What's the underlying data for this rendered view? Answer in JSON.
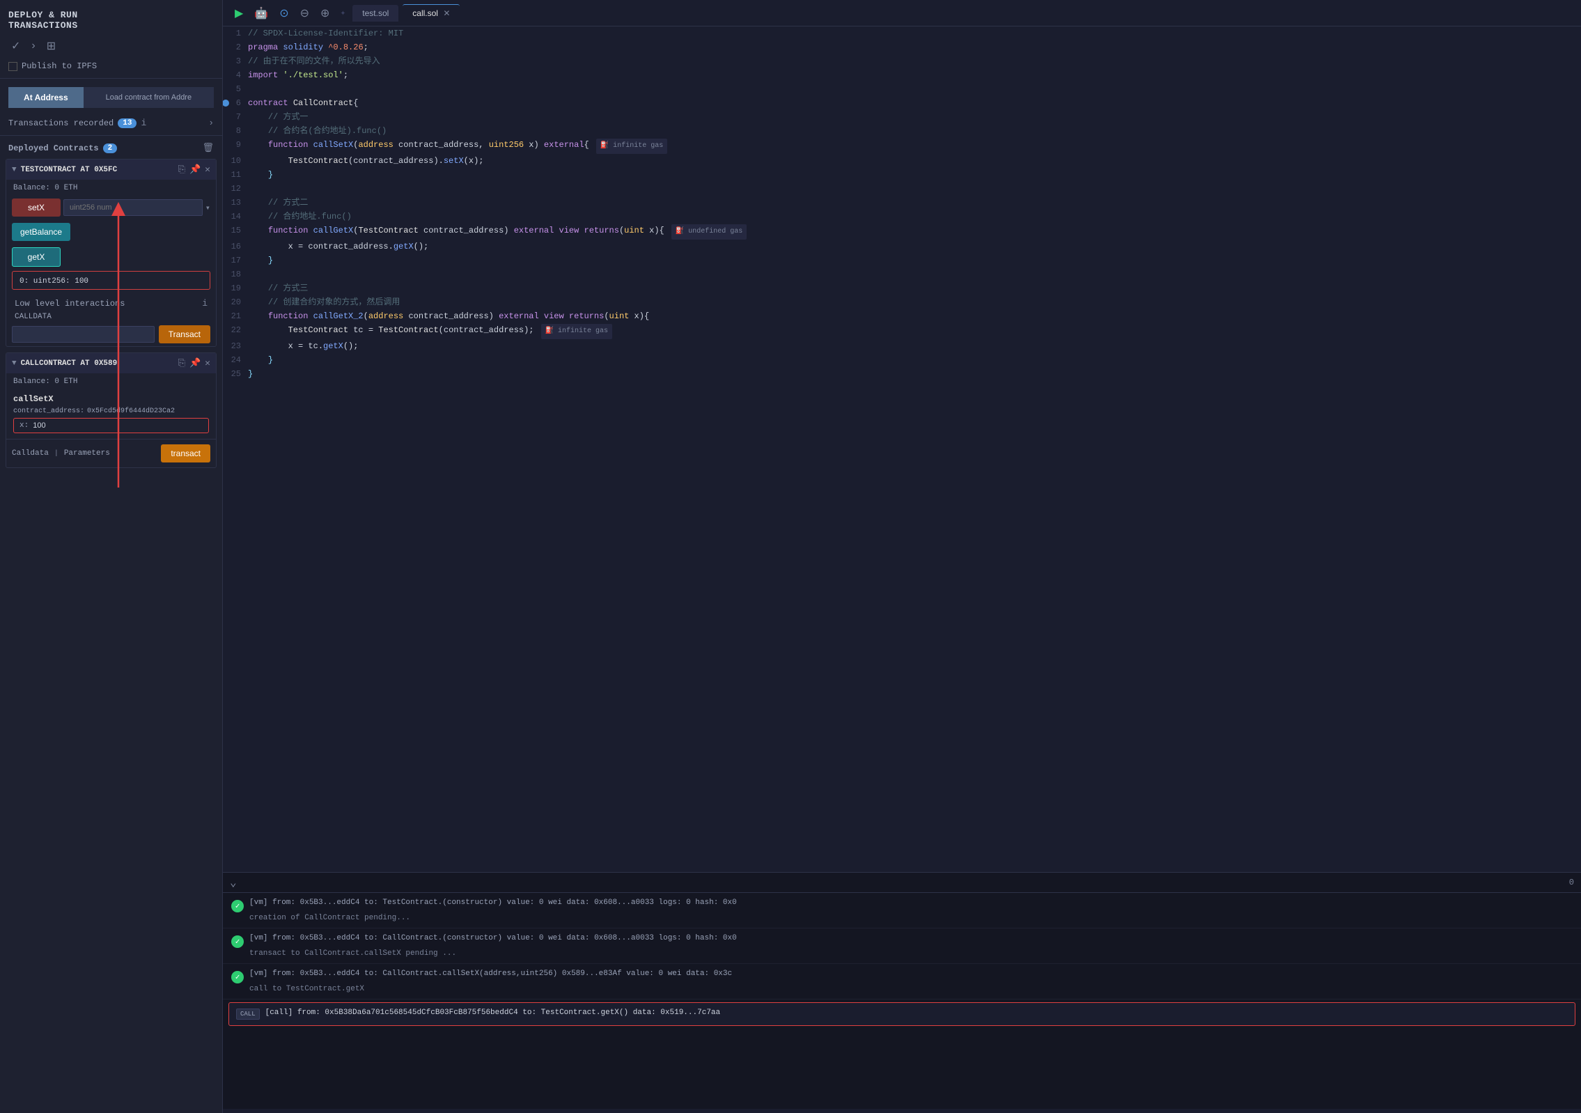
{
  "left": {
    "title": "DEPLOY & RUN\nTRANSACTIONS",
    "publish_label": "Publish to IPFS",
    "at_address_btn": "At Address",
    "load_contract_btn": "Load contract from Addre",
    "transactions_label": "Transactions recorded",
    "transactions_count": "13",
    "deployed_label": "Deployed Contracts",
    "deployed_count": "2",
    "contract1": {
      "name": "TESTCONTRACT AT 0X5FC",
      "balance": "Balance: 0 ETH",
      "func1_label": "setX",
      "func1_placeholder": "uint256 num",
      "func2_label": "getBalance",
      "func3_label": "getX",
      "func3_result": "0: uint256: 100"
    },
    "low_level": {
      "title": "Low level interactions",
      "calldata_label": "CALLDATA",
      "transact_btn": "Transact"
    },
    "contract2": {
      "name": "CALLCONTRACT AT 0X589",
      "balance": "Balance: 0 ETH",
      "section_label": "callSetX",
      "param1_label": "contract_address:",
      "param1_value": "0x5Fcd5d9f6444dD23Ca2",
      "x_label": "x:",
      "x_value": "100",
      "calldata_label": "Calldata",
      "params_label": "Parameters",
      "transact_btn": "transact"
    }
  },
  "editor": {
    "toolbar": {
      "play_icon": "▶",
      "robot_icon": "🤖",
      "toggle_icon": "⊙",
      "zoom_out_icon": "⊖",
      "zoom_in_icon": "⊕",
      "tab1_label": "test.sol",
      "tab2_label": "call.sol"
    },
    "lines": [
      {
        "num": 1,
        "content": "// SPDX-License-Identifier: MIT"
      },
      {
        "num": 2,
        "content": "pragma solidity ^0.8.26;"
      },
      {
        "num": 3,
        "content": "// 由于在不同的文件，所以先导入"
      },
      {
        "num": 4,
        "content": "import './test.sol';"
      },
      {
        "num": 5,
        "content": ""
      },
      {
        "num": 6,
        "content": "contract CallContract{"
      },
      {
        "num": 7,
        "content": "    // 方式一"
      },
      {
        "num": 8,
        "content": "    // 合约名(合约地址).func()"
      },
      {
        "num": 9,
        "content": "    function callSetX(address contract_address, uint256 x) external{",
        "gas": "infinite gas"
      },
      {
        "num": 10,
        "content": "        TestContract(contract_address).setX(x);"
      },
      {
        "num": 11,
        "content": "    }"
      },
      {
        "num": 12,
        "content": ""
      },
      {
        "num": 13,
        "content": "    // 方式二"
      },
      {
        "num": 14,
        "content": "    // 合约地址.func()"
      },
      {
        "num": 15,
        "content": "    function callGetX(TestContract contract_address) external view returns(uint x){",
        "gas": "undefined gas"
      },
      {
        "num": 16,
        "content": "        x = contract_address.getX();"
      },
      {
        "num": 17,
        "content": "    }"
      },
      {
        "num": 18,
        "content": ""
      },
      {
        "num": 19,
        "content": "    // 方式三"
      },
      {
        "num": 20,
        "content": "    // 创建合约对象的方式，然后调用"
      },
      {
        "num": 21,
        "content": "    function callGetX_2(address contract_address) external view returns(uint x){"
      },
      {
        "num": 22,
        "content": "        TestContract tc = TestContract(contract_address);",
        "gas": "infinite gas"
      },
      {
        "num": 23,
        "content": "        x = tc.getX();"
      },
      {
        "num": 24,
        "content": "    }"
      },
      {
        "num": 25,
        "content": "}"
      }
    ]
  },
  "console": {
    "divider_num": "0",
    "logs": [
      {
        "type": "success",
        "text": "[vm]  from: 0x5B3...eddC4 to: TestContract.(constructor) value: 0 wei data: 0x608...a0033 logs: 0 hash: 0x0",
        "sub": "creation of CallContract pending..."
      },
      {
        "type": "success",
        "text": "[vm]  from: 0x5B3...eddC4 to: CallContract.(constructor) value: 0 wei data: 0x608...a0033 logs: 0 hash: 0x0",
        "sub": "transact to CallContract.callSetX pending ..."
      },
      {
        "type": "success",
        "text": "[vm]  from: 0x5B3...eddC4 to: CallContract.callSetX(address,uint256) 0x589...e83Af value: 0 wei data: 0x3c",
        "sub": "call to TestContract.getX"
      },
      {
        "type": "call",
        "badge": "CALL",
        "text": "[call]  from: 0x5B38Da6a701c568545dCfcB03FcB875f56beddC4 to: TestContract.getX() data: 0x519...7c7aa"
      }
    ]
  }
}
